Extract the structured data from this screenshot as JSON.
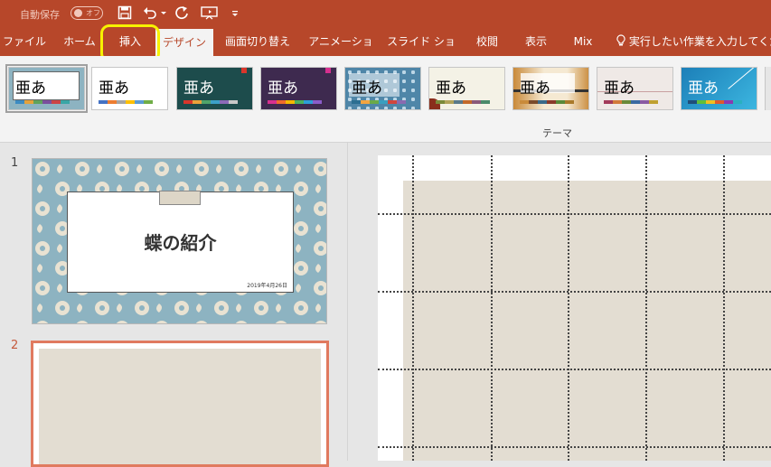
{
  "titlebar": {
    "autosave_label": "自動保存",
    "autosave_state": "オフ",
    "icons": [
      "save-icon",
      "undo-icon",
      "dropdown-icon",
      "redo-icon",
      "present-icon",
      "customize-icon"
    ]
  },
  "tabs": [
    {
      "label": "ファイル"
    },
    {
      "label": "ホーム"
    },
    {
      "label": "挿入"
    },
    {
      "label": "デザイン",
      "active": true
    },
    {
      "label": "画面切り替え"
    },
    {
      "label": "アニメーション"
    },
    {
      "label": "スライド ショー"
    },
    {
      "label": "校閲"
    },
    {
      "label": "表示"
    },
    {
      "label": "Mix"
    }
  ],
  "help_search": "実行したい作業を入力してください",
  "ribbon": {
    "group_label": "テーマ",
    "themes": [
      {
        "label": "亜あ",
        "bg": "#8db3c1",
        "text": "#333333"
      },
      {
        "label": "亜あ",
        "bg": "#ffffff",
        "text": "#333333"
      },
      {
        "label": "亜あ",
        "bg": "#1d4c4c",
        "text": "#ffffff"
      },
      {
        "label": "亜あ",
        "bg": "#3e2a4f",
        "text": "#ffffff"
      },
      {
        "label": "亜あ",
        "bg": "#4f86a8",
        "text": "#ffffff"
      },
      {
        "label": "亜あ",
        "bg": "#f4f2e6",
        "text": "#333333"
      },
      {
        "label": "亜あ",
        "bg": "#f2e2c4",
        "text": "#333333"
      },
      {
        "label": "亜あ",
        "bg": "#efe9e6",
        "text": "#555555"
      },
      {
        "label": "亜あ",
        "bg": "#2a9fd0",
        "text": "#ffffff"
      }
    ]
  },
  "slides": [
    {
      "number": "1",
      "title": "蝶の紹介",
      "date": "2019年4月26日"
    },
    {
      "number": "2"
    }
  ],
  "colors": {
    "accent": "#b7472a",
    "highlight": "#f7f200"
  }
}
